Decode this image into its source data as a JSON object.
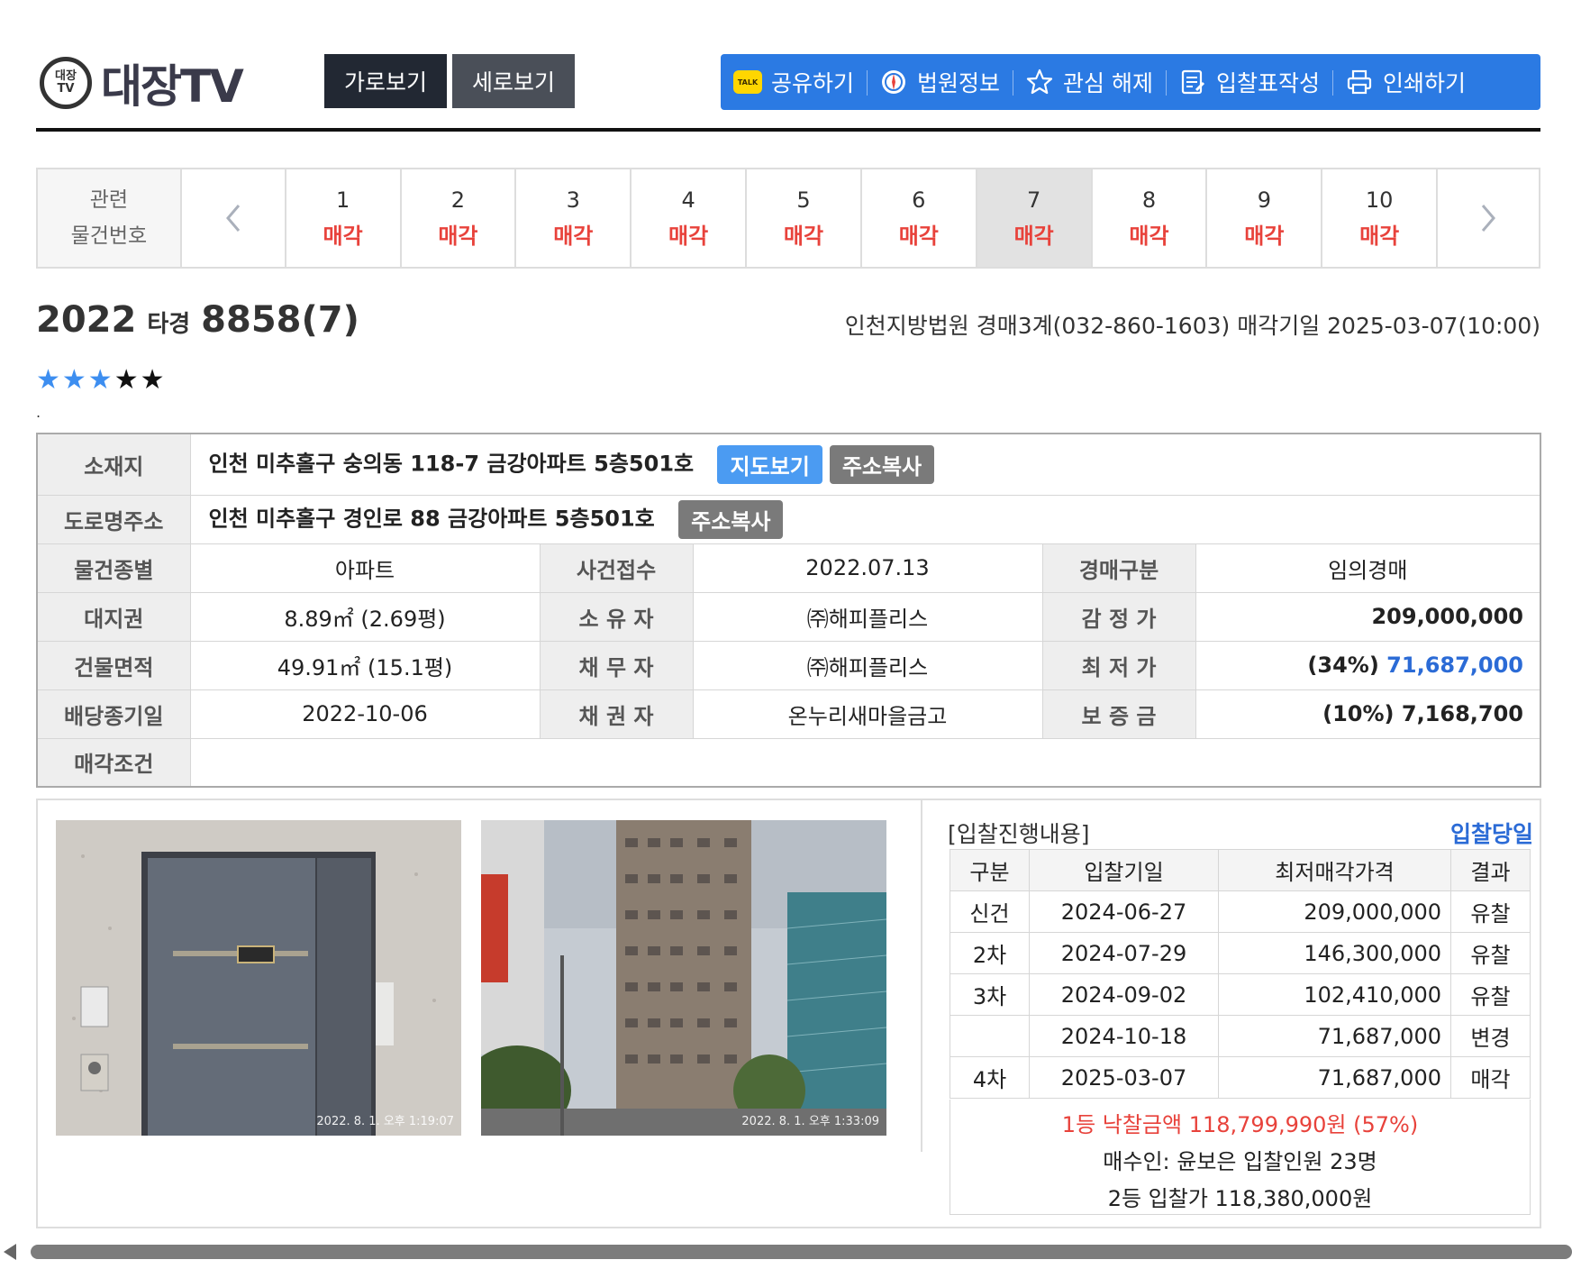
{
  "header": {
    "logo_badge_top": "대장",
    "logo_badge_bottom": "TV",
    "logo_text": "대장TV",
    "view_horizontal": "가로보기",
    "view_vertical": "세로보기",
    "tools": [
      {
        "icon": "kakao-talk-icon",
        "label": "공유하기"
      },
      {
        "icon": "court-emblem-icon",
        "label": "법원정보"
      },
      {
        "icon": "star-outline-icon",
        "label": "관심 해제"
      },
      {
        "icon": "bid-form-icon",
        "label": "입찰표작성"
      },
      {
        "icon": "printer-icon",
        "label": "인쇄하기"
      }
    ],
    "toolbar_color": "#2b7ae3"
  },
  "pager": {
    "label_line1": "관련",
    "label_line2": "물건번호",
    "items": [
      {
        "num": "1",
        "status": "매각"
      },
      {
        "num": "2",
        "status": "매각"
      },
      {
        "num": "3",
        "status": "매각"
      },
      {
        "num": "4",
        "status": "매각"
      },
      {
        "num": "5",
        "status": "매각"
      },
      {
        "num": "6",
        "status": "매각"
      },
      {
        "num": "7",
        "status": "매각"
      },
      {
        "num": "8",
        "status": "매각"
      },
      {
        "num": "9",
        "status": "매각"
      },
      {
        "num": "10",
        "status": "매각"
      }
    ],
    "active_index": 6
  },
  "case": {
    "year": "2022",
    "type": "타경",
    "number": "8858(7)",
    "court_info": "인천지방법원 경매3계(032-860-1603) 매각기일 2025-03-07(10:00)",
    "rating_on": "★★★",
    "rating_off": "★★",
    "dot": "."
  },
  "info": {
    "location_label": "소재지",
    "location": "인천 미추홀구 숭의동 118-7 금강아파트 5층501호",
    "map_button": "지도보기",
    "copy_button": "주소복사",
    "road_label": "도로명주소",
    "road": "인천 미추홀구 경인로 88 금강아파트 5층501호",
    "rows": [
      {
        "h1": "물건종별",
        "v1": "아파트",
        "h2": "사건접수",
        "v2": "2022.07.13",
        "h3": "경매구분",
        "v3": "임의경매"
      },
      {
        "h1": "대지권",
        "v1": "8.89㎡ (2.69평)",
        "h2": "소 유 자",
        "v2": "㈜해피플리스",
        "h3": "감 정 가",
        "v3": "209,000,000"
      },
      {
        "h1": "건물면적",
        "v1": "49.91㎡ (15.1평)",
        "h2": "채 무 자",
        "v2": "㈜해피플리스",
        "h3": "최 저 가",
        "v3_prefix": "(34%)",
        "v3_value": "71,687,000"
      },
      {
        "h1": "배당종기일",
        "v1": "2022-10-06",
        "h2": "채 권 자",
        "v2": "온누리새마을금고",
        "h3": "보 증 금",
        "v3": "(10%) 7,168,700"
      }
    ],
    "condition_label": "매각조건",
    "condition": ""
  },
  "photos": {
    "photo1_stamp": "2022. 8. 1. 오후 1:19:07",
    "photo2_stamp": "2022. 8. 1. 오후 1:33:09"
  },
  "bidding": {
    "title": "[입찰진행내용]",
    "day_label": "입찰당일",
    "headers": [
      "구분",
      "입찰기일",
      "최저매각가격",
      "결과"
    ],
    "rows": [
      {
        "round": "신건",
        "date": "2024-06-27",
        "price": "209,000,000",
        "result": "유찰",
        "kind": "fail"
      },
      {
        "round": "2차",
        "date": "2024-07-29",
        "price": "146,300,000",
        "result": "유찰",
        "kind": "fail"
      },
      {
        "round": "3차",
        "date": "2024-09-02",
        "price": "102,410,000",
        "result": "유찰",
        "kind": "fail"
      },
      {
        "round": "",
        "date": "2024-10-18",
        "price": "71,687,000",
        "result": "변경",
        "kind": "change"
      },
      {
        "round": "4차",
        "date": "2025-03-07",
        "price": "71,687,000",
        "result": "매각",
        "kind": "sold"
      }
    ],
    "winner_line": "1등 낙찰금액 118,799,990원 (57%)",
    "buyer_line": "매수인: 윤보은 입찰인원 23명",
    "second_line": "2등 입찰가 118,380,000원"
  }
}
